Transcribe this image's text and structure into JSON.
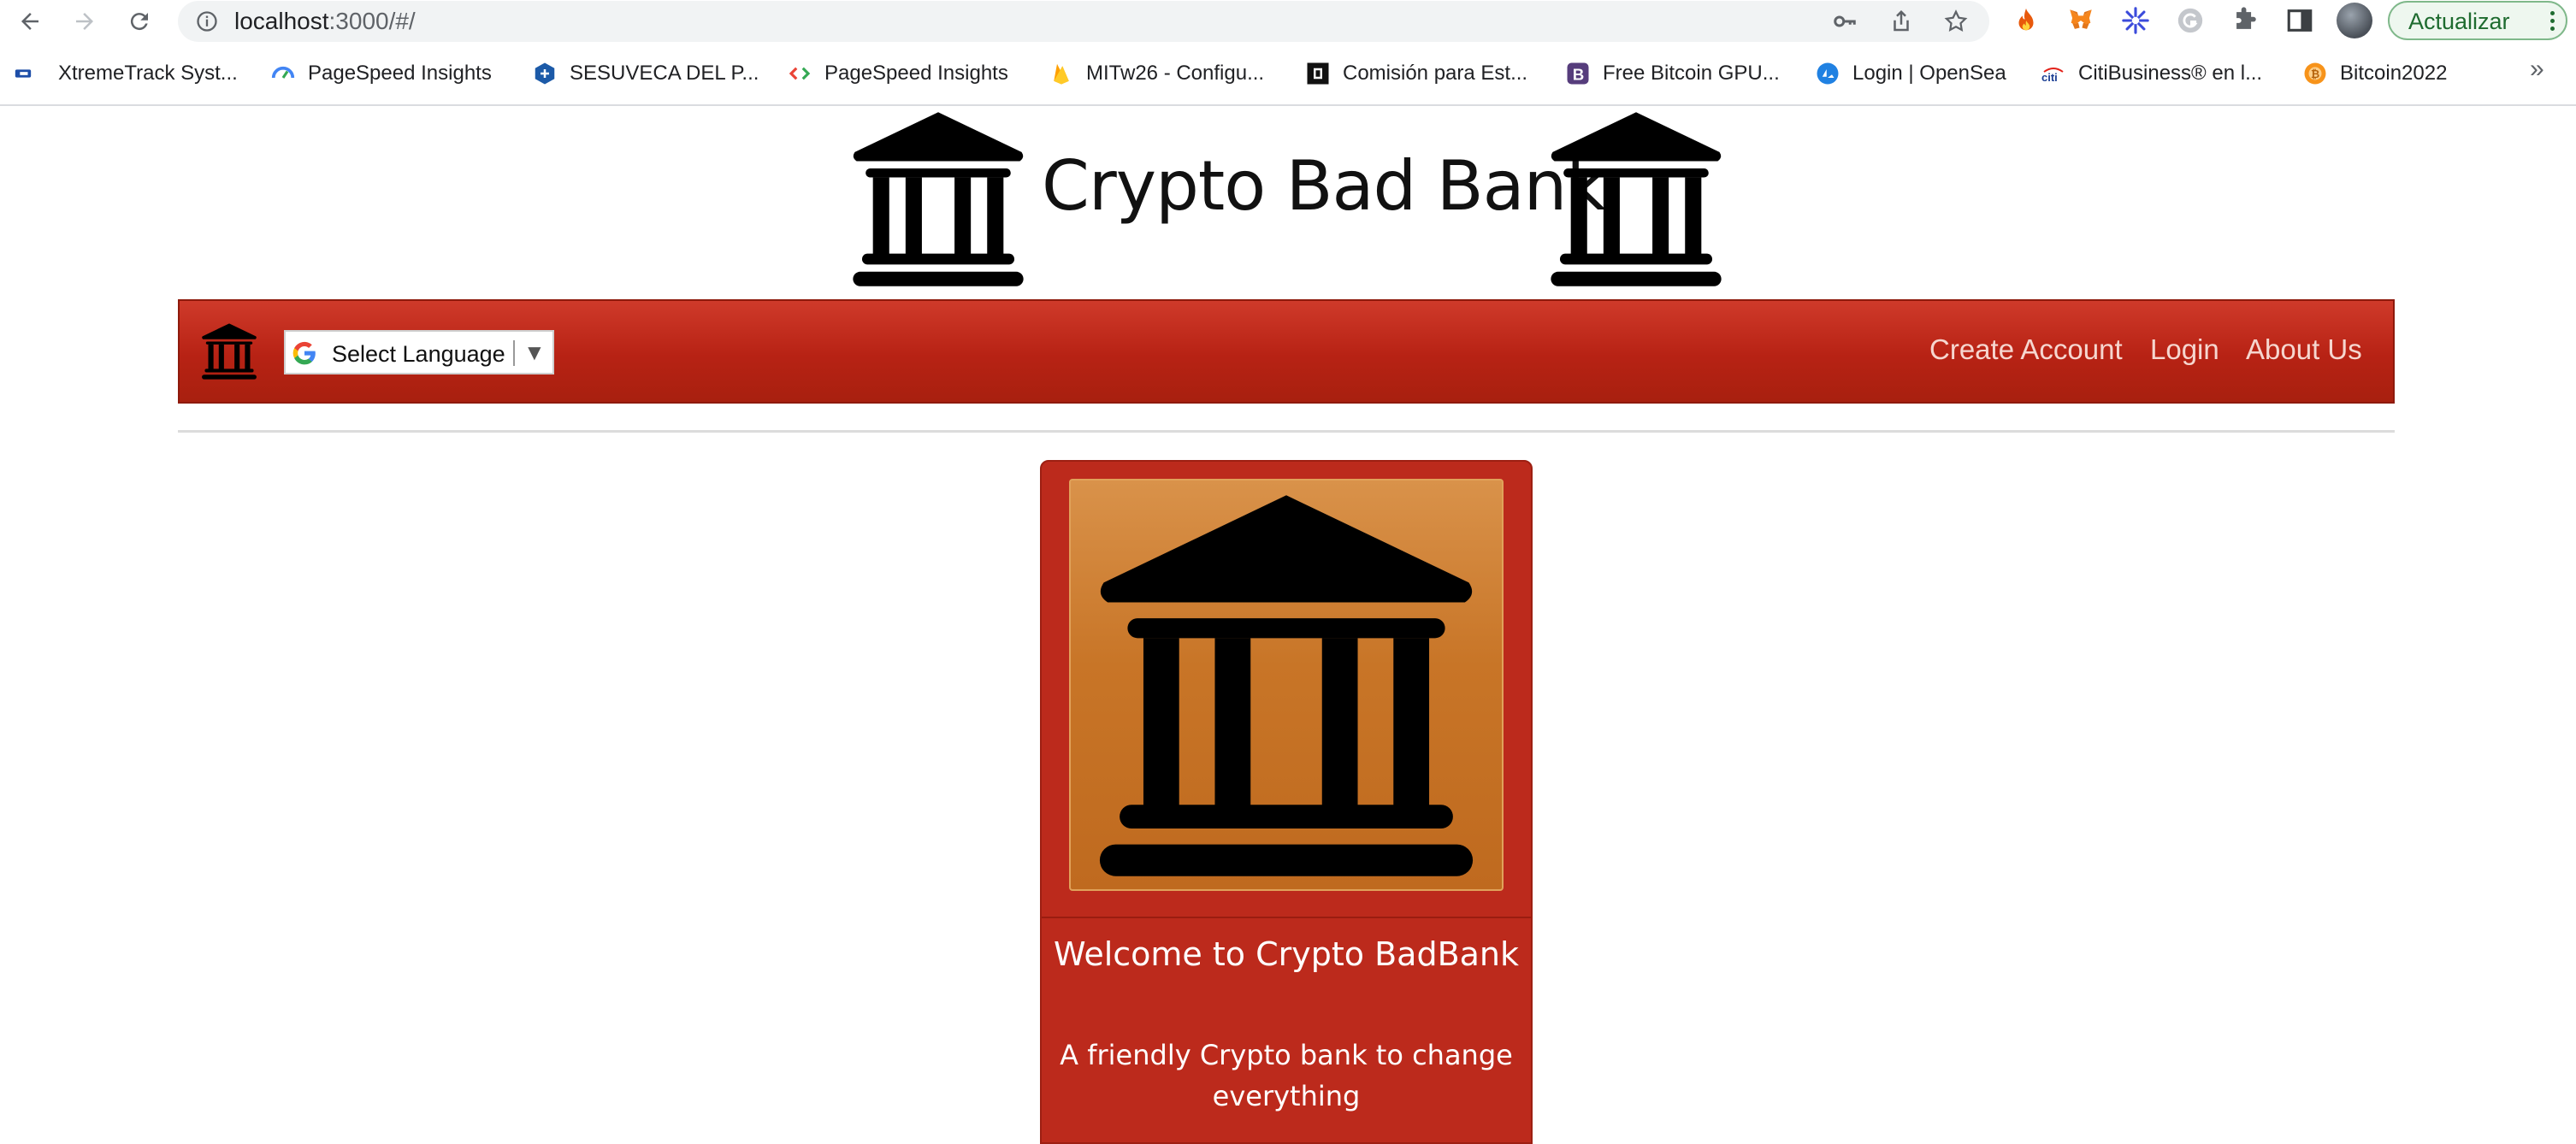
{
  "browser": {
    "url_host": "localhost",
    "url_rest": ":3000/#/",
    "update_button_label": "Actualizar",
    "icons": [
      "back-icon",
      "forward-icon",
      "reload-icon",
      "site-info-icon",
      "key-icon",
      "share-icon",
      "bookmark-star-icon",
      "fire-extension-icon",
      "metamask-extension-icon",
      "sparkle-extension-icon",
      "grammarly-extension-icon",
      "puzzle-extensions-icon",
      "side-panel-icon",
      "profile-avatar",
      "more-menu-icon"
    ]
  },
  "bookmarks": {
    "items": [
      {
        "label": "XtremeTrack Syst...",
        "icon": "xtremetrack-icon"
      },
      {
        "label": "PageSpeed Insights",
        "icon": "pagespeed-icon"
      },
      {
        "label": "SESUVECA DEL P...",
        "icon": "sesuveca-icon"
      },
      {
        "label": "PageSpeed Insights",
        "icon": "pagespeed-code-icon"
      },
      {
        "label": "MITw26 - Configu...",
        "icon": "firebase-icon"
      },
      {
        "label": "Comisión para Est...",
        "icon": "comision-icon"
      },
      {
        "label": "Free Bitcoin GPU...",
        "icon": "bootstrap-icon"
      },
      {
        "label": "Login | OpenSea",
        "icon": "opensea-icon"
      },
      {
        "label": "CitiBusiness® en l...",
        "icon": "citi-icon"
      },
      {
        "label": "Bitcoin2022",
        "icon": "bitcoin-icon"
      }
    ],
    "more": "»"
  },
  "site": {
    "title": "Crypto Bad Bank",
    "language_select": "Select Language",
    "language_arrow": "▼",
    "nav_links": [
      "Create Account",
      "Login",
      "About Us"
    ],
    "card": {
      "title": "Welcome to Crypto BadBank",
      "text": "A friendly Crypto bank to change everything"
    }
  },
  "colors": {
    "navbar": "#b72214",
    "card": "#bc2a1c",
    "card_image": "#c87527"
  }
}
